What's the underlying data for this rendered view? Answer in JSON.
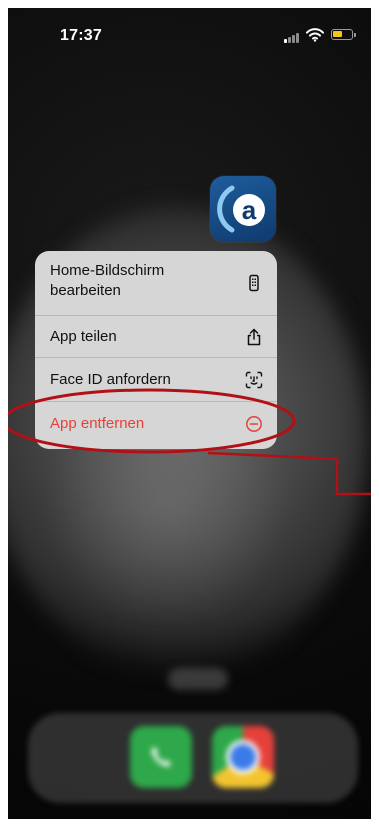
{
  "status_bar": {
    "time": "17:37"
  },
  "app_icon": {
    "name": "a-app-icon",
    "glyph": "a"
  },
  "context_menu": {
    "items": [
      {
        "label_line1": "Home-Bildschirm",
        "label_line2": "bearbeiten",
        "icon": "phone-screen-icon"
      },
      {
        "label": "App teilen",
        "icon": "share-icon"
      },
      {
        "label": "Face ID anfordern",
        "icon": "face-id-icon"
      },
      {
        "label": "App entfernen",
        "icon": "minus-circle-icon",
        "destructive": true
      }
    ]
  },
  "annotation": {
    "highlight_color": "#b11116",
    "target": "App entfernen"
  },
  "dock": {
    "apps": [
      "phone-app-icon",
      "chrome-app-icon"
    ]
  },
  "colors": {
    "destructive": "#e5413a",
    "menu_bg": "#d6d6d6",
    "app_icon_bg": "#1f5d9c",
    "annotation": "#b11116"
  }
}
